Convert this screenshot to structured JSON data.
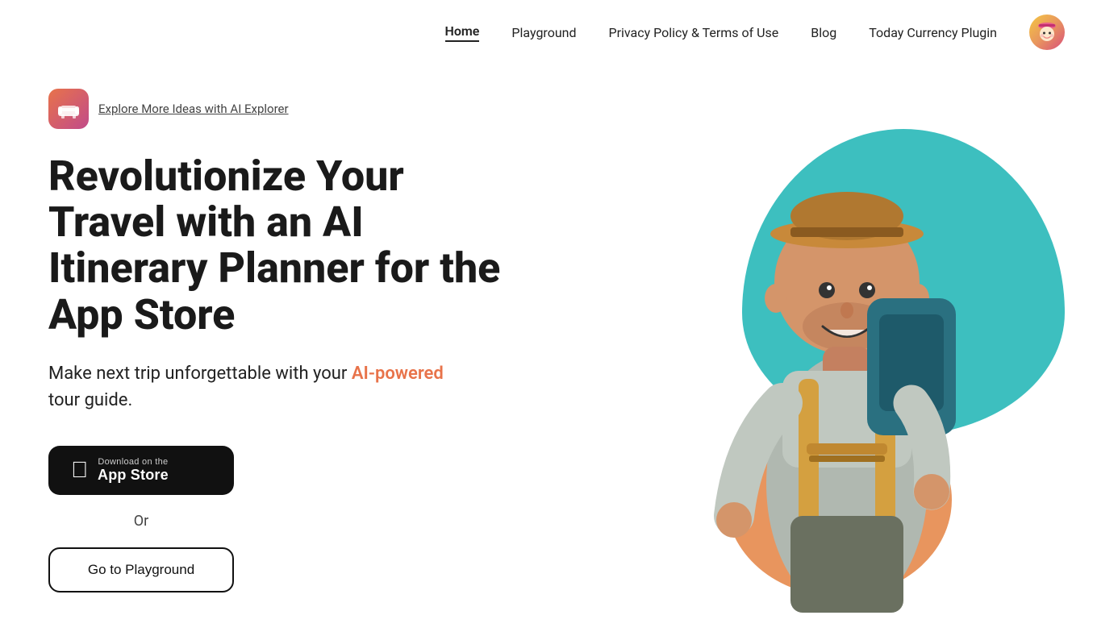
{
  "nav": {
    "links": [
      {
        "label": "Home",
        "active": true,
        "id": "home"
      },
      {
        "label": "Playground",
        "active": false,
        "id": "playground"
      },
      {
        "label": "Privacy Policy & Terms of Use",
        "active": false,
        "id": "privacy"
      },
      {
        "label": "Blog",
        "active": false,
        "id": "blog"
      },
      {
        "label": "Today Currency Plugin",
        "active": false,
        "id": "currency"
      }
    ],
    "avatar_alt": "User avatar"
  },
  "hero": {
    "badge_text": "Explore More Ideas with AI Explorer",
    "headline": "Revolutionize Your Travel with an AI Itinerary Planner for the App Store",
    "subheadline_prefix": "Make next trip unforgettable with your ",
    "subheadline_highlight": "AI-powered",
    "subheadline_suffix": " tour guide.",
    "appstore_small": "Download on the",
    "appstore_large": "App Store",
    "or_label": "Or",
    "playground_btn_label": "Go to Playground"
  }
}
